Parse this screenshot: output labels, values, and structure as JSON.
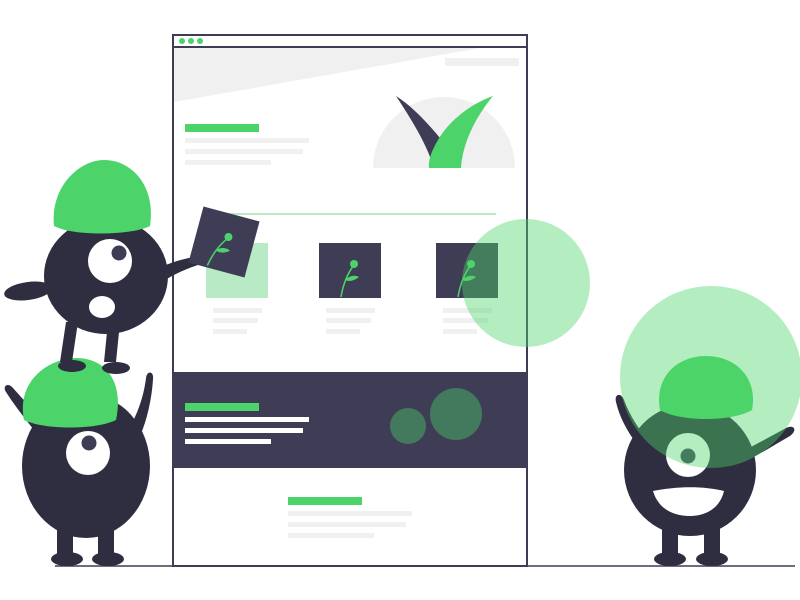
{
  "illustration": {
    "colors": {
      "accent_green": "#4cd46a",
      "light_green": "#b8ebc5",
      "dark_navy": "#2f2e41",
      "panel_navy": "#3f3d56",
      "placeholder_gray": "#f0f0f0",
      "frame_gray": "#3f3d56",
      "white": "#ffffff"
    },
    "icons": [
      "window-dot-icon",
      "checkmark-icon",
      "sprout-icon"
    ],
    "characters": [
      "monster-top-left",
      "monster-bottom-left",
      "monster-right"
    ]
  }
}
